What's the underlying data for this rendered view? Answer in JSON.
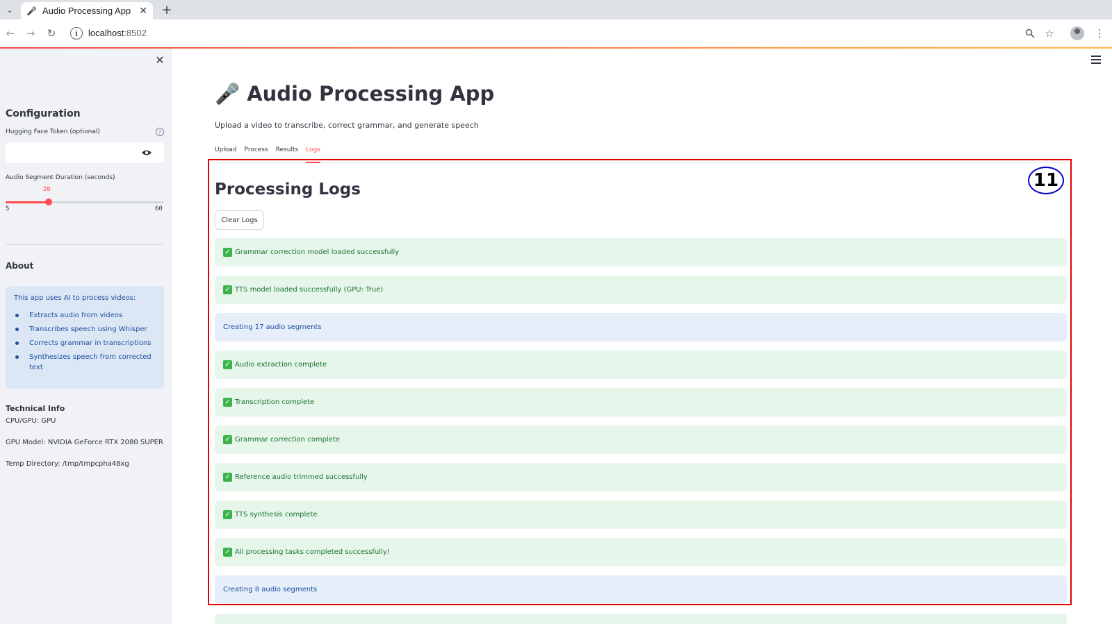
{
  "browser": {
    "tab_title": "Audio Processing App",
    "url_host": "localhost",
    "url_port": ":8502"
  },
  "sidebar": {
    "config_heading": "Configuration",
    "token_label": "Hugging Face Token (optional)",
    "token_value": "",
    "segment_label": "Audio Segment Duration (seconds)",
    "slider": {
      "value": "20",
      "min": "5",
      "max": "60",
      "level_fraction": 0.273
    },
    "about_heading": "About",
    "about_intro": "This app uses AI to process videos:",
    "about_items": [
      "Extracts audio from videos",
      "Transcribes speech using Whisper",
      "Corrects grammar in transcriptions",
      "Synthesizes speech from corrected text"
    ],
    "tech_heading": "Technical Info",
    "tech_lines": [
      "CPU/GPU: GPU",
      "GPU Model: NVIDIA GeForce RTX 2080 SUPER",
      "Temp Directory: /tmp/tmpcpha48xg"
    ]
  },
  "main": {
    "title": "🎤 Audio Processing App",
    "subtitle": "Upload a video to transcribe, correct grammar, and generate speech",
    "tabs": [
      "Upload",
      "Process",
      "Results",
      "Logs"
    ],
    "active_tab": "Logs",
    "badge": "11",
    "section_title": "Processing Logs",
    "clear_button": "Clear Logs",
    "logs": [
      {
        "type": "success",
        "text": "Grammar correction model loaded successfully"
      },
      {
        "type": "success",
        "text": "TTS model loaded successfully (GPU: True)"
      },
      {
        "type": "info",
        "text": "Creating 17 audio segments"
      },
      {
        "type": "success",
        "text": "Audio extraction complete"
      },
      {
        "type": "success",
        "text": "Transcription complete"
      },
      {
        "type": "success",
        "text": "Grammar correction complete"
      },
      {
        "type": "success",
        "text": "Reference audio trimmed successfully"
      },
      {
        "type": "success",
        "text": "TTS synthesis complete"
      },
      {
        "type": "success",
        "text": "All processing tasks completed successfully!"
      },
      {
        "type": "info",
        "text": "Creating 8 audio segments"
      }
    ]
  },
  "colors": {
    "accent": "#ff4b4b",
    "success_bg": "#e7f6ea",
    "success_text": "#177233",
    "info_bg": "#e6eefa",
    "info_text": "#1e4fa1",
    "highlight_border": "#e00000",
    "badge_border": "#0000cc"
  }
}
